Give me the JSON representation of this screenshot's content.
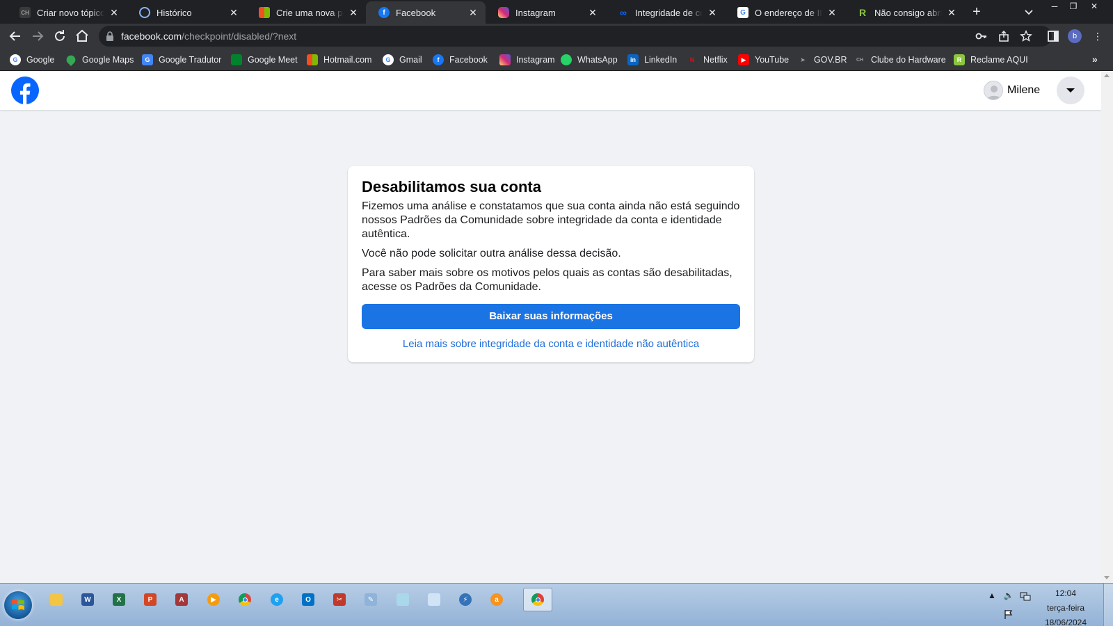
{
  "browser": {
    "tabs": [
      {
        "title": "Criar novo tópico - C",
        "icon": "clube-hardware-icon",
        "color": "#3a3a3a"
      },
      {
        "title": "Histórico",
        "icon": "history-icon",
        "color": "#8ab4f8"
      },
      {
        "title": "Crie uma nova pergunta",
        "icon": "microsoft-icon",
        "color": "#f25022"
      },
      {
        "title": "Facebook",
        "icon": "facebook-icon",
        "color": "#1877f2"
      },
      {
        "title": "Instagram",
        "icon": "instagram-icon",
        "color": "#e1306c"
      },
      {
        "title": "Integridade de conta",
        "icon": "meta-icon",
        "color": "#0866ff"
      },
      {
        "title": "O endereço de IP que",
        "icon": "google-icon",
        "color": "#ffffff"
      },
      {
        "title": "Não consigo abrir um",
        "icon": "reclame-aqui-icon",
        "color": "#8cc63f"
      }
    ],
    "active_tab": 3,
    "url_host": "facebook.com",
    "url_path": "/checkpoint/disabled/?next",
    "profile_initial": "b",
    "bookmarks": [
      {
        "label": "Google",
        "icon": "google-icon",
        "color": "#ffffff",
        "glyph": "G"
      },
      {
        "label": "Google Maps",
        "icon": "maps-pin-icon",
        "color": "#34a853",
        "glyph": ""
      },
      {
        "label": "Google Tradutor",
        "icon": "translate-icon",
        "color": "#4285f4",
        "glyph": "G"
      },
      {
        "label": "Google Meet",
        "icon": "meet-icon",
        "color": "#00832d",
        "glyph": ""
      },
      {
        "label": "Hotmail.com",
        "icon": "microsoft-icon",
        "color": "#f25022",
        "glyph": ""
      },
      {
        "label": "Gmail",
        "icon": "google-icon",
        "color": "#ffffff",
        "glyph": "G"
      },
      {
        "label": "Facebook",
        "icon": "facebook-icon",
        "color": "#1877f2",
        "glyph": "f"
      },
      {
        "label": "Instagram",
        "icon": "instagram-icon",
        "color": "#e1306c",
        "glyph": ""
      },
      {
        "label": "WhatsApp",
        "icon": "whatsapp-icon",
        "color": "#25d366",
        "glyph": ""
      },
      {
        "label": "LinkedIn",
        "icon": "linkedin-icon",
        "color": "#0a66c2",
        "glyph": "in"
      },
      {
        "label": "Netflix",
        "icon": "netflix-icon",
        "color": "#35363a",
        "glyph": "N"
      },
      {
        "label": "YouTube",
        "icon": "youtube-icon",
        "color": "#ff0000",
        "glyph": "▶"
      },
      {
        "label": "GOV.BR",
        "icon": "govbr-icon",
        "color": "#35363a",
        "glyph": "➤"
      },
      {
        "label": "Clube do Hardware",
        "icon": "clube-hardware-icon",
        "color": "#35363a",
        "glyph": "CH"
      },
      {
        "label": "Reclame AQUI",
        "icon": "reclame-aqui-icon",
        "color": "#8cc63f",
        "glyph": "R"
      }
    ]
  },
  "facebook": {
    "user_name": "Milene",
    "card": {
      "title": "Desabilitamos sua conta",
      "paragraph1": "Fizemos uma análise e constatamos que sua conta ainda não está seguindo nossos Padrões da Comunidade sobre integridade da conta e identidade autêntica.",
      "paragraph2": "Você não pode solicitar outra análise dessa decisão.",
      "paragraph3": "Para saber mais sobre os motivos pelos quais as contas são desabilitadas, acesse os Padrões da Comunidade.",
      "primary_button": "Baixar suas informações",
      "learn_more_link": "Leia mais sobre integridade da conta e identidade não autêntica"
    }
  },
  "taskbar": {
    "apps": [
      {
        "name": "explorer-icon",
        "color": "#f4c542",
        "glyph": ""
      },
      {
        "name": "word-icon",
        "color": "#2b579a",
        "glyph": "W"
      },
      {
        "name": "excel-icon",
        "color": "#217346",
        "glyph": "X"
      },
      {
        "name": "powerpoint-icon",
        "color": "#d24726",
        "glyph": "P"
      },
      {
        "name": "access-icon",
        "color": "#a4373a",
        "glyph": "A"
      },
      {
        "name": "media-player-icon",
        "color": "#f39c12",
        "glyph": "▶"
      },
      {
        "name": "chrome-icon",
        "color": "#db4437",
        "glyph": ""
      },
      {
        "name": "internet-explorer-icon",
        "color": "#1ea1f1",
        "glyph": "e"
      },
      {
        "name": "outlook-icon",
        "color": "#0072c6",
        "glyph": "O"
      },
      {
        "name": "tool-icon",
        "color": "#c0392b",
        "glyph": "✂"
      },
      {
        "name": "paint-icon",
        "color": "#8fb3d9",
        "glyph": "✎"
      },
      {
        "name": "notepad-icon",
        "color": "#a8d8ea",
        "glyph": ""
      },
      {
        "name": "document-icon",
        "color": "#d0e4f5",
        "glyph": ""
      },
      {
        "name": "flash-icon",
        "color": "#3573b9",
        "glyph": "⚡"
      },
      {
        "name": "avast-icon",
        "color": "#f7931e",
        "glyph": "a"
      },
      {
        "name": "chrome-icon",
        "color": "#db4437",
        "glyph": ""
      }
    ],
    "active_app": 15,
    "time": "12:04",
    "weekday": "terça-feira",
    "date": "18/06/2024"
  }
}
